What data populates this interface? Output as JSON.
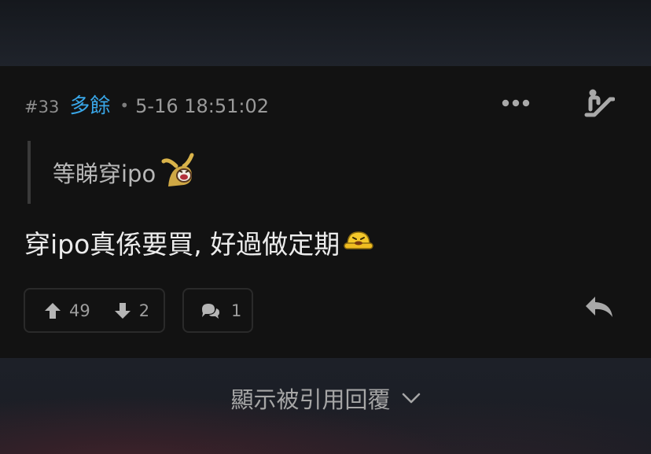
{
  "post": {
    "number": "#33",
    "author": "多餘",
    "separator": "•",
    "timestamp": "5-16 18:51:02",
    "quote_text": "等睇穿ipo",
    "body_text": "穿ipo真係要買, 好過做定期",
    "upvotes": "49",
    "downvotes": "2",
    "replies": "1"
  },
  "footer": {
    "show_quoted_replies": "顯示被引用回覆"
  },
  "icons": {
    "more": "more-dots-icon",
    "escalator": "escalator-icon",
    "upvote": "arrow-up-icon",
    "downvote": "arrow-down-icon",
    "comment": "comment-bubbles-icon",
    "quote_reply": "reply-arrow-icon",
    "expand": "chevron-down-icon",
    "emoji_quote": "bunny-laugh-emoji",
    "emoji_body": "yellow-face-emoji"
  },
  "colors": {
    "author": "#39a6e7",
    "card_bg": "#121212",
    "page_bg": "#1b1e25"
  }
}
